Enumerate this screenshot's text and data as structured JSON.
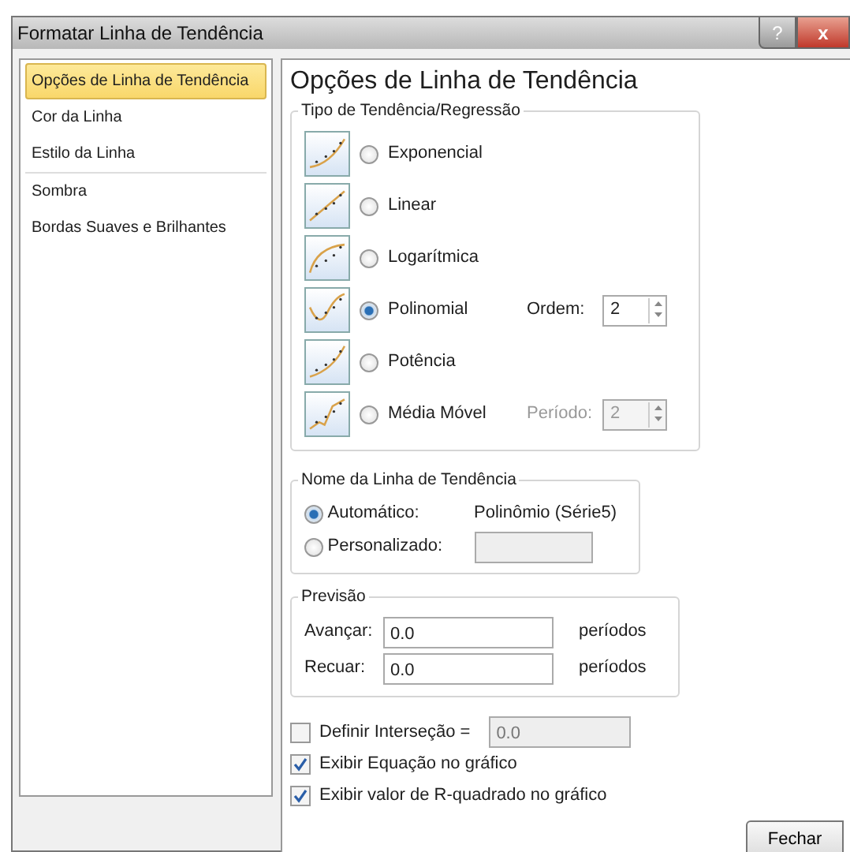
{
  "window": {
    "title": "Formatar Linha de Tendência",
    "help": "?",
    "close": "x"
  },
  "sidebar": {
    "items": [
      {
        "label": "Opções de Linha de Tendência",
        "selected": true
      },
      {
        "label": "Cor da Linha",
        "selected": false
      },
      {
        "label": "Estilo da Linha",
        "selected": false
      },
      {
        "label": "Sombra",
        "selected": false
      },
      {
        "label": "Bordas Suaves e Brilhantes",
        "selected": false
      }
    ]
  },
  "panel": {
    "title": "Opções de Linha de Tendência",
    "trend_group": {
      "legend": "Tipo de Tendência/Regressão",
      "types": [
        {
          "kind": "exponential",
          "label": "Exponencial",
          "selected": false
        },
        {
          "kind": "linear",
          "label": "Linear",
          "selected": false
        },
        {
          "kind": "logarithmic",
          "label": "Logarítmica",
          "selected": false
        },
        {
          "kind": "polynomial",
          "label": "Polinomial",
          "selected": true,
          "option": {
            "label": "Ordem:",
            "value": "2",
            "disabled": false
          }
        },
        {
          "kind": "power",
          "label": "Potência",
          "selected": false
        },
        {
          "kind": "moving_average",
          "label": "Média Móvel",
          "selected": false,
          "option": {
            "label": "Período:",
            "value": "2",
            "disabled": true
          }
        }
      ]
    },
    "name_group": {
      "legend": "Nome da Linha de Tendência",
      "options": [
        {
          "label": "Automático:",
          "selected": true,
          "value": "Polinômio (Série5)"
        },
        {
          "label": "Personalizado:",
          "selected": false
        }
      ]
    },
    "forecast_group": {
      "legend": "Previsão",
      "rows": [
        {
          "label": "Avançar:",
          "value": "0.0",
          "unit": "períodos"
        },
        {
          "label": "Recuar:",
          "value": "0.0",
          "unit": "períodos"
        }
      ]
    },
    "checks": [
      {
        "label": "Definir Interseção =",
        "checked": false,
        "value": "0.0"
      },
      {
        "label": "Exibir Equação no gráfico",
        "checked": true
      },
      {
        "label": "Exibir valor de R-quadrado no gráfico",
        "checked": true
      }
    ]
  },
  "buttons": [
    "Fechar"
  ]
}
